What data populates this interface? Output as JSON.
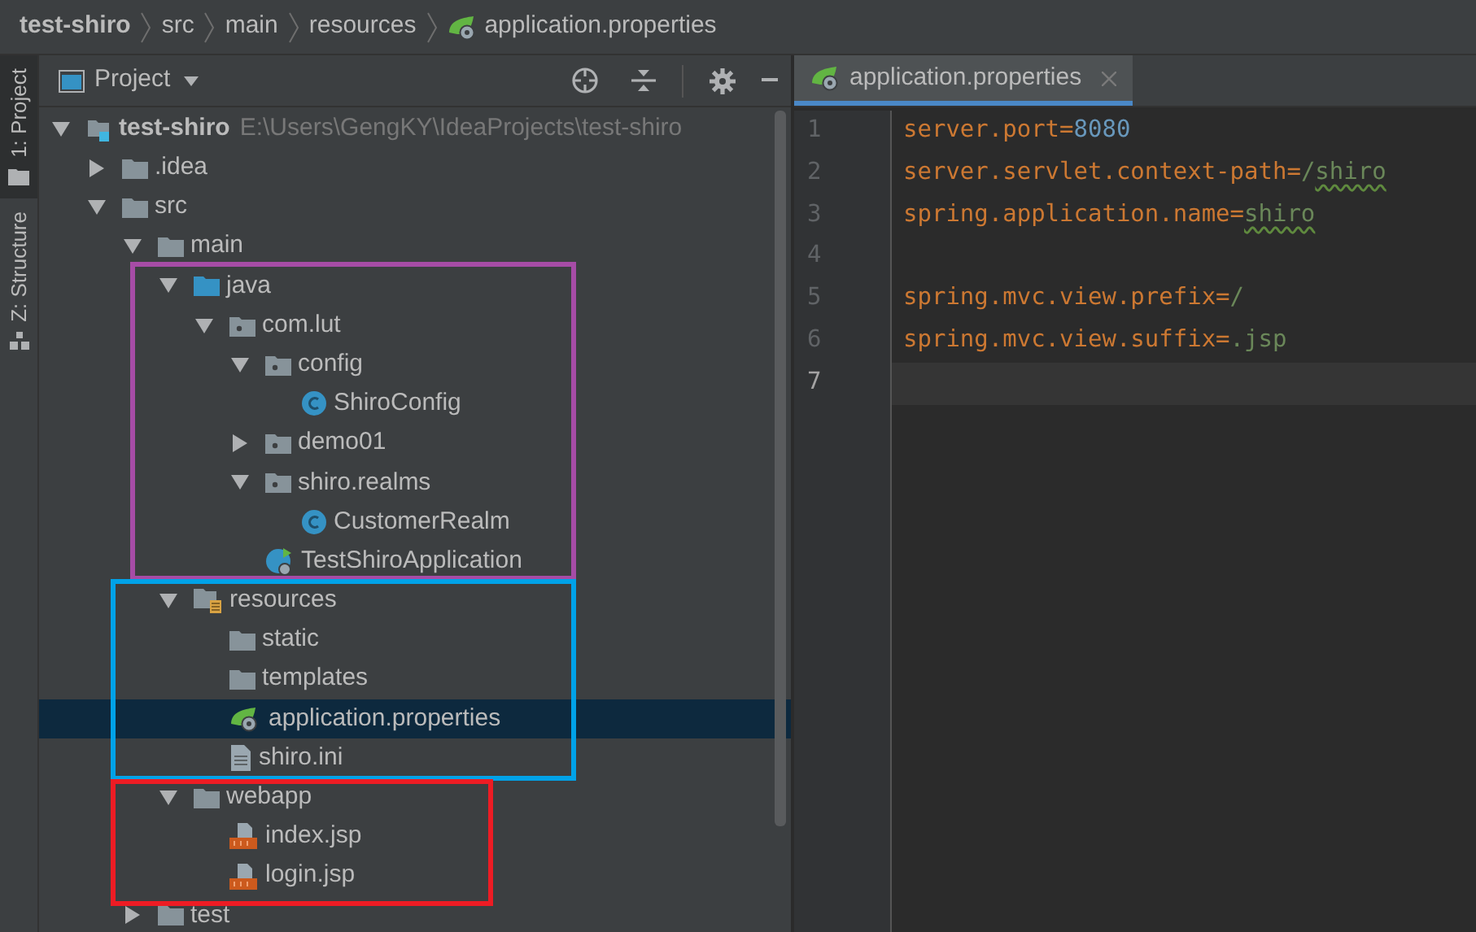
{
  "breadcrumb": [
    {
      "label": "test-shiro",
      "kind": "module"
    },
    {
      "label": "src",
      "kind": "folder"
    },
    {
      "label": "main",
      "kind": "folder"
    },
    {
      "label": "resources",
      "kind": "folder"
    },
    {
      "label": "application.properties",
      "kind": "spring-props"
    }
  ],
  "tool_strip": [
    {
      "label": "1: Project",
      "kind": "project",
      "selected": true
    },
    {
      "label": "Z: Structure",
      "kind": "structure",
      "selected": false
    }
  ],
  "project_panel": {
    "title": "Project",
    "tree": [
      {
        "label": "test-shiro",
        "path": "E:\\Users\\GengKY\\IdeaProjects\\test-shiro",
        "kind": "module",
        "expanded": true,
        "selected": false,
        "children": [
          {
            "label": ".idea",
            "kind": "folder",
            "expanded": false,
            "selected": false
          },
          {
            "label": "src",
            "kind": "folder",
            "expanded": true,
            "selected": false,
            "children": [
              {
                "label": "main",
                "kind": "folder",
                "expanded": true,
                "selected": false,
                "children": [
                  {
                    "label": "java",
                    "kind": "source-folder",
                    "expanded": true,
                    "selected": false,
                    "children": [
                      {
                        "label": "com.lut",
                        "kind": "package",
                        "expanded": true,
                        "selected": false,
                        "children": [
                          {
                            "label": "config",
                            "kind": "package",
                            "expanded": true,
                            "selected": false,
                            "children": [
                              {
                                "label": "ShiroConfig",
                                "kind": "class",
                                "selected": false
                              }
                            ]
                          },
                          {
                            "label": "demo01",
                            "kind": "package",
                            "expanded": false,
                            "selected": false
                          },
                          {
                            "label": "shiro.realms",
                            "kind": "package",
                            "expanded": true,
                            "selected": false,
                            "children": [
                              {
                                "label": "CustomerRealm",
                                "kind": "class",
                                "selected": false
                              }
                            ]
                          },
                          {
                            "label": "TestShiroApplication",
                            "kind": "spring-app",
                            "selected": false
                          }
                        ]
                      }
                    ]
                  },
                  {
                    "label": "resources",
                    "kind": "resources-folder",
                    "expanded": true,
                    "selected": false,
                    "children": [
                      {
                        "label": "static",
                        "kind": "folder",
                        "selected": false
                      },
                      {
                        "label": "templates",
                        "kind": "folder",
                        "selected": false
                      },
                      {
                        "label": "application.properties",
                        "kind": "spring-props",
                        "selected": true
                      },
                      {
                        "label": "shiro.ini",
                        "kind": "text-file",
                        "selected": false
                      }
                    ]
                  },
                  {
                    "label": "webapp",
                    "kind": "folder",
                    "expanded": true,
                    "selected": false,
                    "children": [
                      {
                        "label": "index.jsp",
                        "kind": "jsp",
                        "selected": false
                      },
                      {
                        "label": "login.jsp",
                        "kind": "jsp",
                        "selected": false
                      }
                    ]
                  }
                ]
              },
              {
                "label": "test",
                "kind": "folder",
                "expanded": false,
                "selected": false
              }
            ]
          }
        ]
      }
    ],
    "annotations": [
      {
        "color": "#a64ca6"
      },
      {
        "color": "#00a2e8"
      },
      {
        "color": "#ed1c24"
      }
    ]
  },
  "editor": {
    "tabs": [
      {
        "label": "application.properties",
        "kind": "spring-props",
        "selected": true
      }
    ],
    "lines": [
      {
        "number": "1",
        "key": "server.port=",
        "value": [
          {
            "text": "8080",
            "kind": "number",
            "flagged": false
          }
        ],
        "current": false
      },
      {
        "number": "2",
        "key": "server.servlet.context-path=",
        "value": [
          {
            "text": "/",
            "kind": "string",
            "flagged": false
          },
          {
            "text": "shiro",
            "kind": "string",
            "flagged": true
          }
        ],
        "current": false
      },
      {
        "number": "3",
        "key": "spring.application.name=",
        "value": [
          {
            "text": "shiro",
            "kind": "string",
            "flagged": true
          }
        ],
        "current": false
      },
      {
        "number": "4",
        "current": false
      },
      {
        "number": "5",
        "key": "spring.mvc.view.prefix=",
        "value": [
          {
            "text": "/",
            "kind": "string",
            "flagged": false
          }
        ],
        "current": false
      },
      {
        "number": "6",
        "key": "spring.mvc.view.suffix=",
        "value": [
          {
            "text": ".jsp",
            "kind": "string",
            "flagged": false
          }
        ],
        "current": false
      },
      {
        "number": "7",
        "current": true
      }
    ]
  }
}
